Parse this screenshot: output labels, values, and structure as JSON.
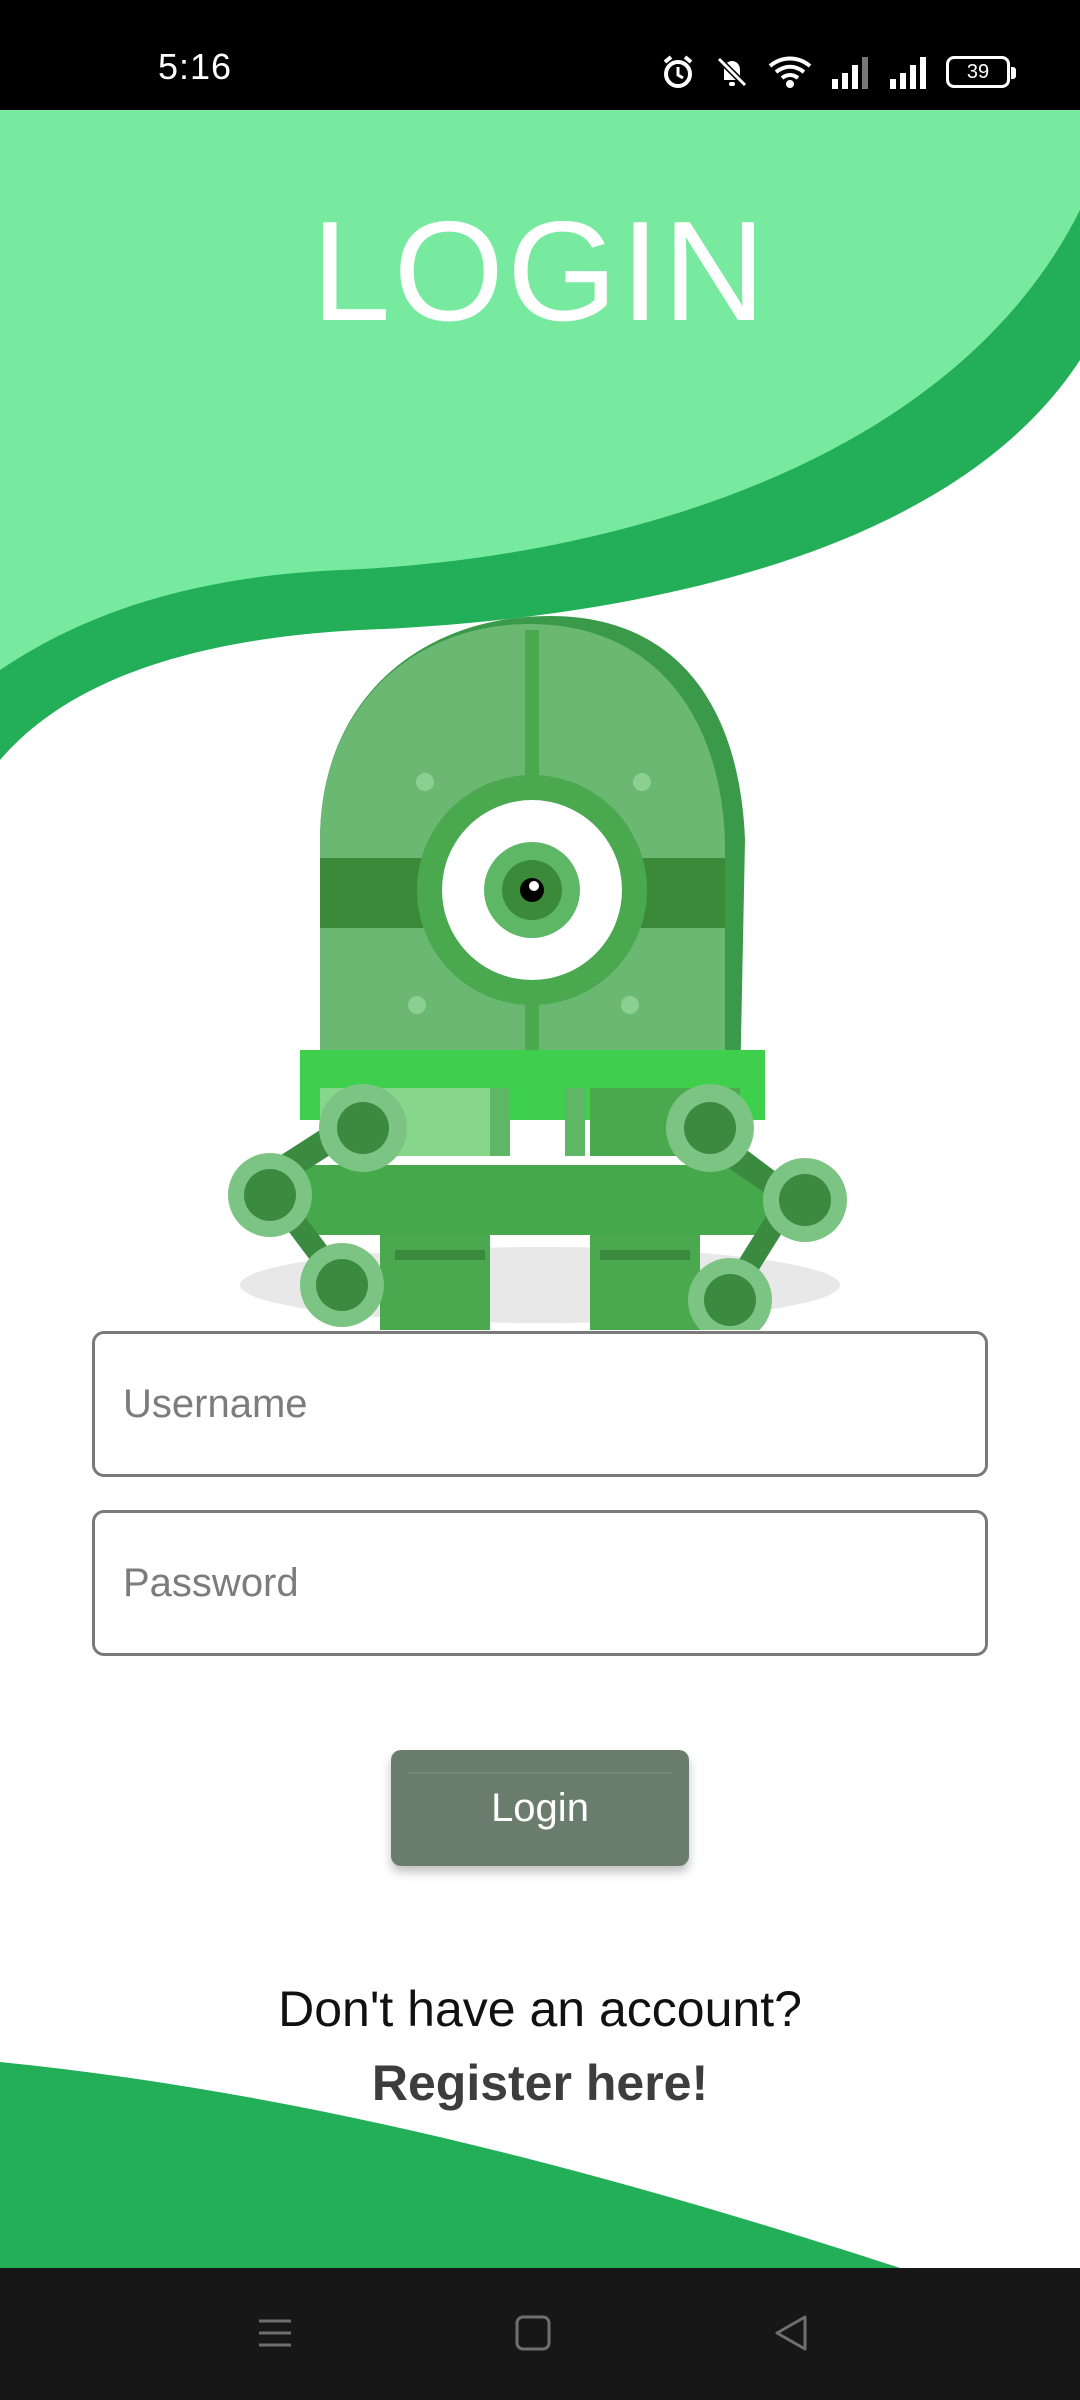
{
  "status": {
    "time": "5:16",
    "battery": "39",
    "icons": [
      "alarm-icon",
      "bell-off-icon",
      "wifi-icon",
      "signal-icon",
      "signal-icon"
    ]
  },
  "header": {
    "title": "LOGIN"
  },
  "form": {
    "username_placeholder": "Username",
    "password_placeholder": "Password",
    "login_label": "Login"
  },
  "footer": {
    "question": "Don't have an account?",
    "register_link": "Register here!"
  },
  "nav": {
    "icons": [
      "menu-icon",
      "home-icon",
      "back-icon"
    ]
  },
  "colors": {
    "light_green": "#78eaa0",
    "dark_green": "#22af58",
    "button": "#6a7d6c"
  }
}
